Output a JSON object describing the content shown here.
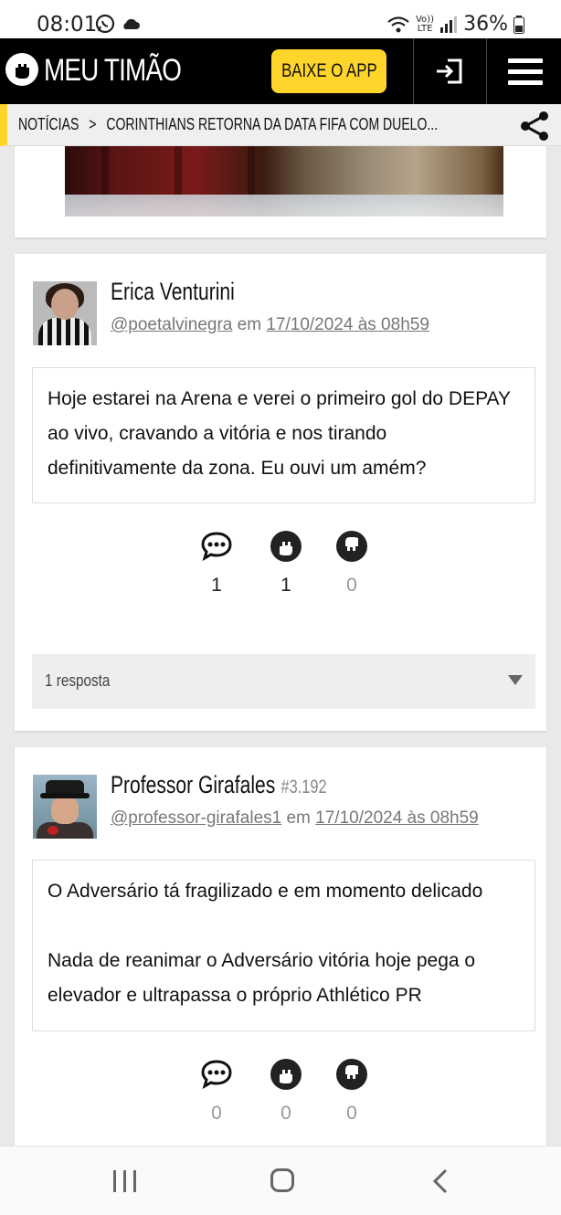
{
  "status_bar": {
    "time": "08:01",
    "network": "LTE",
    "volte": "Vo))",
    "battery": "36%"
  },
  "header": {
    "logo_text": "MEU TIMÃO",
    "app_button": "BAIXE O APP"
  },
  "breadcrumb": {
    "section": "NOTÍCIAS",
    "separator": ">",
    "title": "CORINTHIANS RETORNA DA DATA FIFA COM DUELO..."
  },
  "comments": [
    {
      "name": "Erica Venturini",
      "rank": "",
      "handle": "@poetalvinegra",
      "connector": "em",
      "date": "17/10/2024 às 08h59",
      "paragraphs": [
        "Hoje estarei na Arena e verei o primeiro gol do DEPAY ao vivo, cravando a vitória e nos tirando definitivamente da zona. Eu ouvi um amém?"
      ],
      "counts": {
        "comments": "1",
        "likes": "1",
        "dislikes": "0"
      },
      "replies_label": "1 resposta"
    },
    {
      "name": "Professor Girafales",
      "rank": "#3.192",
      "handle": "@professor-girafales1",
      "connector": "em",
      "date": "17/10/2024 às 08h59",
      "paragraphs": [
        "O Adversário tá fragilizado e em momento delicado",
        "Nada de reanimar o Adversário vitória hoje pega o elevador e ultrapassa o próprio Athlético PR"
      ],
      "counts": {
        "comments": "0",
        "likes": "0",
        "dislikes": "0"
      }
    }
  ],
  "icons": {
    "comment": "speech-bubble-icon",
    "like": "fist-up-icon",
    "dislike": "fist-down-icon",
    "share": "share-icon",
    "login": "login-icon",
    "menu": "hamburger-menu-icon"
  },
  "colors": {
    "accent": "#ffd52b",
    "header_bg": "#000000",
    "page_bg": "#e9e9e9"
  }
}
